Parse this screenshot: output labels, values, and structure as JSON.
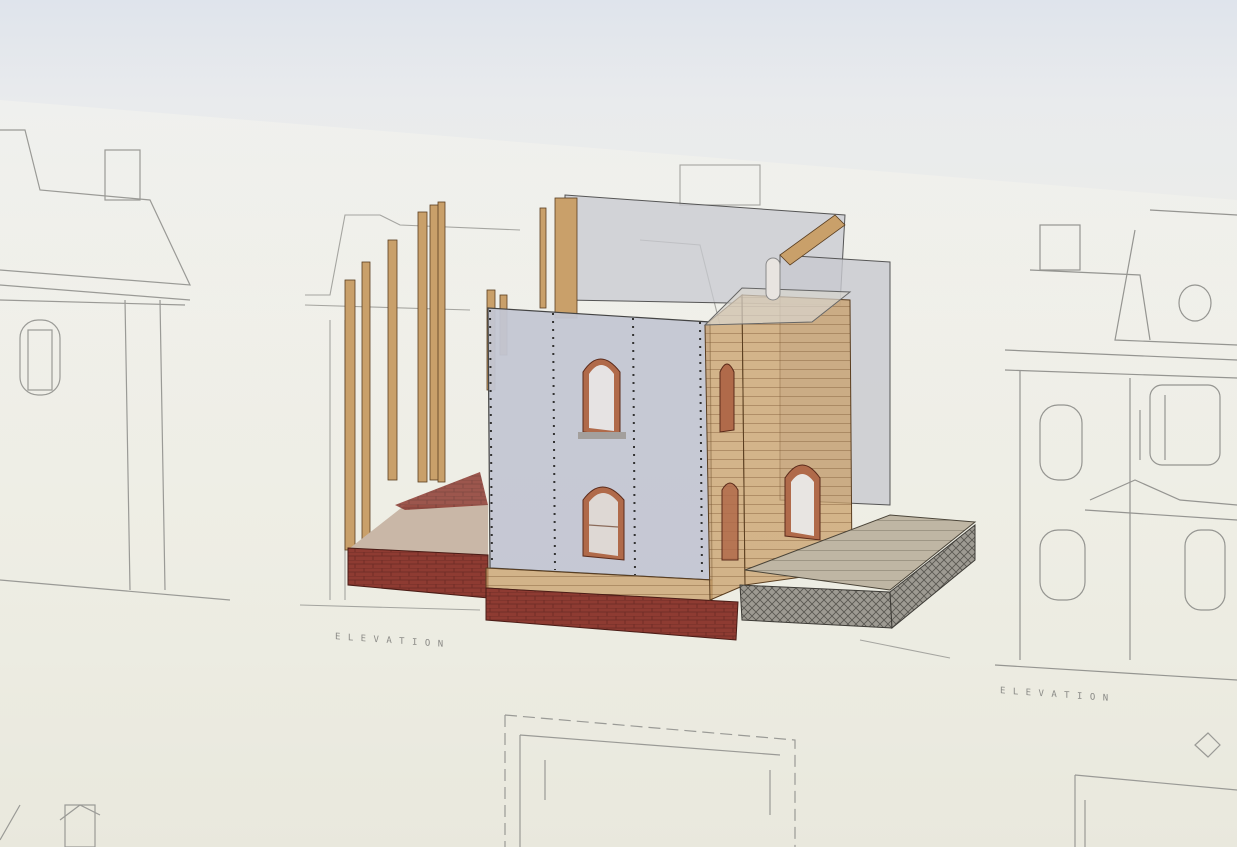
{
  "scene": {
    "sheet_labels": [
      "E L E V A T I O N",
      "E L E V A T I O N"
    ],
    "colors": {
      "background_top": "#dfe4ec",
      "drawing_lines": "#9a9a96",
      "wall_panel": "#c3c6d3",
      "wood": "#c9a06a",
      "brick": "#8e3b32",
      "window_frame": "#b06a4a"
    }
  }
}
